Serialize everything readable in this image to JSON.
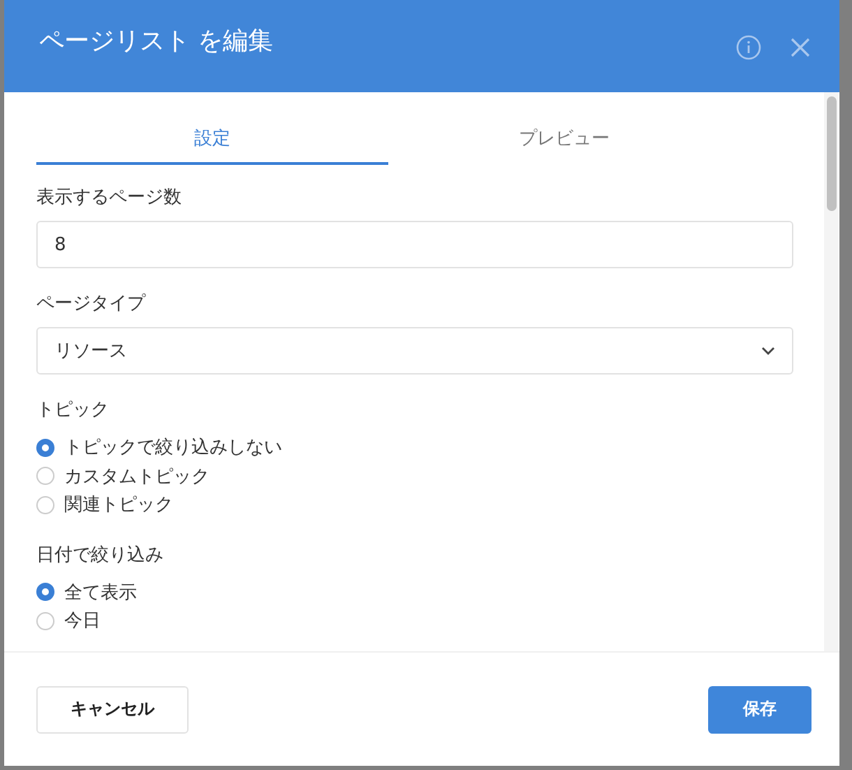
{
  "dialog": {
    "title": "ページリスト を編集"
  },
  "tabs": [
    {
      "label": "設定",
      "selected": true
    },
    {
      "label": "プレビュー",
      "selected": false
    }
  ],
  "fields": [
    {
      "kind": "text",
      "label": "表示するページ数",
      "value": "8"
    },
    {
      "kind": "select",
      "label": "ページタイプ",
      "value": "リソース"
    },
    {
      "kind": "radio",
      "label": "トピック",
      "options": [
        {
          "label": "トピックで絞り込みしない",
          "selected": true
        },
        {
          "label": "カスタムトピック",
          "selected": false
        },
        {
          "label": "関連トピック",
          "selected": false
        }
      ]
    },
    {
      "kind": "radio",
      "label": "日付で絞り込み",
      "options": [
        {
          "label": "全て表示",
          "selected": true
        },
        {
          "label": "今日",
          "selected": false
        }
      ]
    }
  ],
  "buttons": {
    "cancel": "キャンセル",
    "save": "保存"
  }
}
